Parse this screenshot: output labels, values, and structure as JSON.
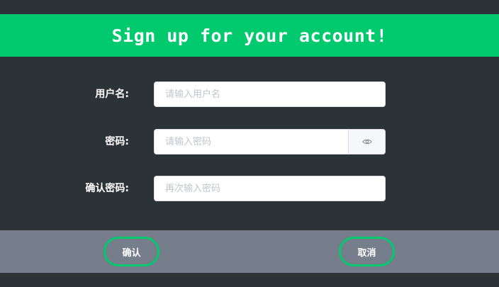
{
  "header": {
    "title": "Sign up for your account!"
  },
  "form": {
    "username": {
      "label": "用户名:",
      "placeholder": "请输入用户名",
      "value": ""
    },
    "password": {
      "label": "密码:",
      "placeholder": "请输入密码",
      "value": "",
      "toggle_icon": "eye-icon"
    },
    "confirm_password": {
      "label": "确认密码:",
      "placeholder": "再次输入密码",
      "value": ""
    }
  },
  "footer": {
    "confirm_label": "确认",
    "cancel_label": "取消"
  },
  "colors": {
    "accent": "#00c96e",
    "background": "#2c3337",
    "footer": "#767e8c",
    "input_border": "#dcdfe6",
    "placeholder": "#c0c4cc"
  }
}
